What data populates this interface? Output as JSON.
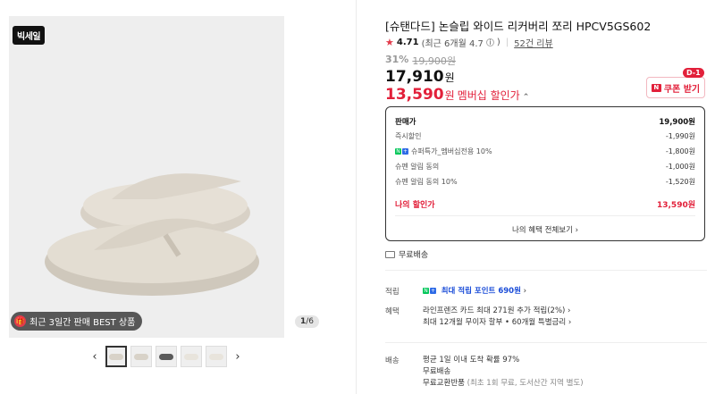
{
  "gallery": {
    "sale_badge": "빅세일",
    "best_badge": "최근 3일간 판매 BEST 상품",
    "page_current": "1",
    "page_total": "/6",
    "prev_arrow": "‹",
    "next_arrow": "›"
  },
  "product": {
    "title": "[슈탠다드] 논슬립 와이드 리커버리 쪼리 HPCV5GS602",
    "rating": "4.71",
    "rating_recent": "(최근 6개월 4.7",
    "review_count": "52건 리뷰",
    "discount_pct": "31%",
    "original_price": "19,900원",
    "price": "17,910",
    "price_unit": "원",
    "member_price": "13,590",
    "member_unit": "원",
    "member_label": "멤버십 할인가",
    "coupon_label": "쿠폰 받기",
    "coupon_dday": "D-1"
  },
  "price_box": {
    "rows": [
      {
        "label": "판매가",
        "value": "19,900원"
      },
      {
        "label": "즉시할인",
        "value": "-1,990원"
      },
      {
        "label": "슈퍼특가_멤버십전용 10%",
        "value": "-1,800원"
      },
      {
        "label": "슈펜 알림 동의",
        "value": "-1,000원"
      },
      {
        "label": "슈펜 알림 동의 10%",
        "value": "-1,520원"
      }
    ],
    "my_price_label": "나의 할인가",
    "my_price_value": "13,590원",
    "all_benefits": "나의 혜택 전체보기"
  },
  "shipping": {
    "free": "무료배송"
  },
  "details": {
    "points_label": "적립",
    "points_text": "최대 적립 포인트 690원",
    "benefit_label": "혜택",
    "benefit_1": "라인프렌즈 카드 최대 271원 추가 적립(2%)",
    "benefit_2": "최대 12개월 무이자 할부 • 60개월 특별금리",
    "delivery_label": "배송",
    "delivery_1": "평균 1일 이내 도착 확률 97%",
    "delivery_2": "무료배송",
    "delivery_3_main": "무료교환반품",
    "delivery_3_sub": "(최초 1회 무료, 도서산간 지역 별도)"
  }
}
